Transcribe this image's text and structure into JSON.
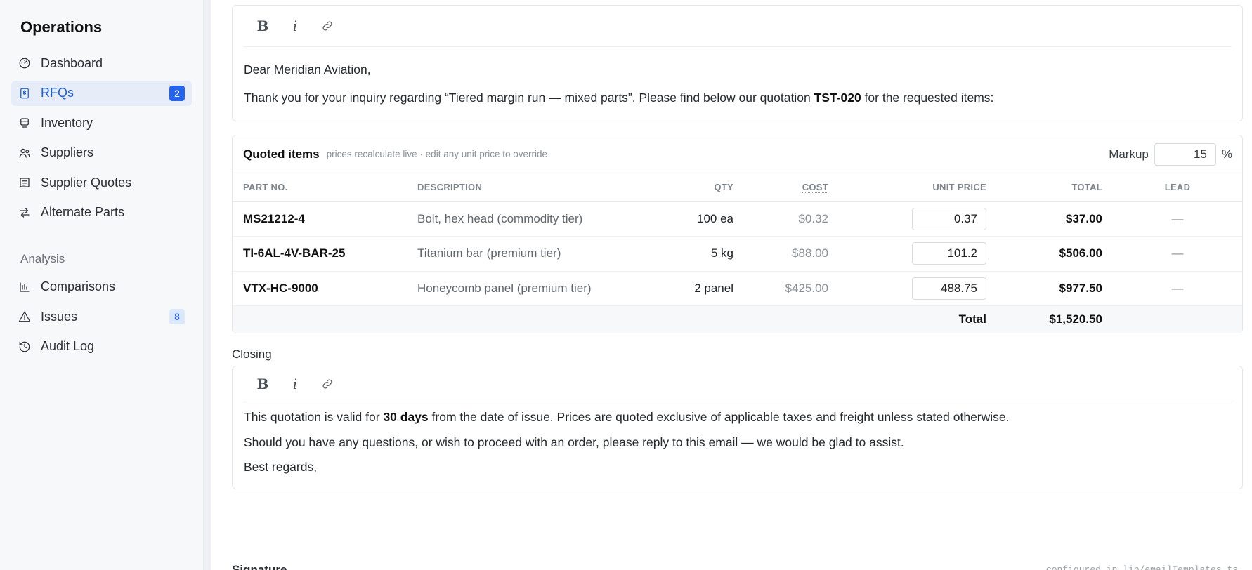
{
  "sidebar": {
    "title": "Operations",
    "items": [
      {
        "label": "Dashboard"
      },
      {
        "label": "RFQs",
        "badge": "2"
      },
      {
        "label": "Inventory"
      },
      {
        "label": "Suppliers"
      },
      {
        "label": "Supplier Quotes"
      },
      {
        "label": "Alternate Parts"
      }
    ],
    "analysis_label": "Analysis",
    "analysis_items": [
      {
        "label": "Comparisons"
      },
      {
        "label": "Issues",
        "badge": "8"
      },
      {
        "label": "Audit Log"
      }
    ],
    "accent": "#2563eb"
  },
  "intro": {
    "greeting": "Dear Meridian Aviation,",
    "line_before": "Thank you for your inquiry regarding “Tiered margin run — mixed parts”. Please find below our quotation ",
    "quote_no": "TST-020",
    "line_after": " for the requested items:"
  },
  "items": {
    "title": "Quoted items",
    "subtitle": "prices recalculate live · edit any unit price to override",
    "markup_label": "Markup",
    "markup_value": "15",
    "markup_unit": "%",
    "columns": {
      "part": "Part No.",
      "desc": "Description",
      "qty": "Qty",
      "cost": "Cost",
      "unit_price": "Unit Price",
      "total": "Total",
      "lead": "Lead"
    },
    "rows": [
      {
        "part": "MS21212-4",
        "desc": "Bolt, hex head (commodity tier)",
        "qty": "100 ea",
        "cost": "$0.32",
        "unit_price": "0.37",
        "total": "$37.00",
        "lead": "—"
      },
      {
        "part": "TI-6AL-4V-BAR-25",
        "desc": "Titanium bar (premium tier)",
        "qty": "5 kg",
        "cost": "$88.00",
        "unit_price": "101.2",
        "total": "$506.00",
        "lead": "—"
      },
      {
        "part": "VTX-HC-9000",
        "desc": "Honeycomb panel (premium tier)",
        "qty": "2 panel",
        "cost": "$425.00",
        "unit_price": "488.75",
        "total": "$977.50",
        "lead": "—"
      }
    ],
    "total_label": "Total",
    "total_value": "$1,520.50"
  },
  "closing": {
    "heading": "Closing",
    "line1_before": "This quotation is valid for ",
    "line1_bold": "30 days",
    "line1_after": " from the date of issue. Prices are quoted exclusive of applicable taxes and freight unless stated otherwise.",
    "line2": "Should you have any questions, or wish to proceed with an order, please reply to this email — we would be glad to assist.",
    "line3": "Best regards,"
  },
  "signature": {
    "heading": "Signature",
    "note": "configured in lib/emailTemplates.ts"
  }
}
